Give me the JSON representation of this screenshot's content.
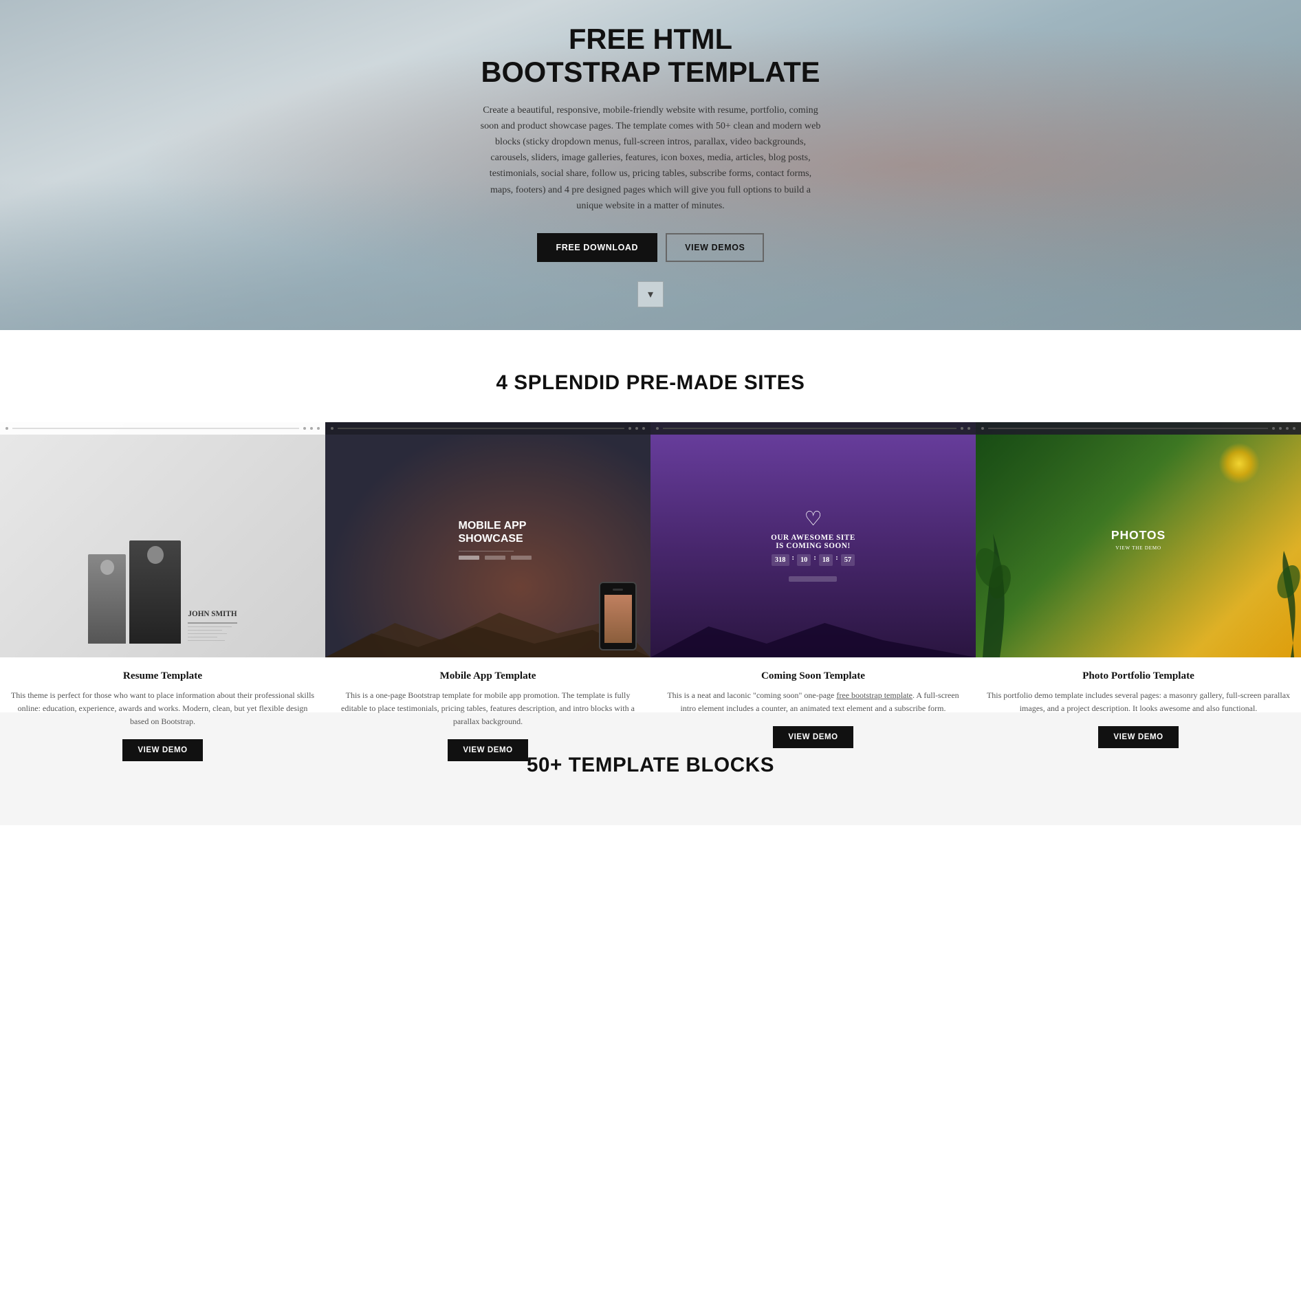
{
  "hero": {
    "title": "FREE HTML BOOTSTRAP TEMPLATE",
    "description": "Create a beautiful, responsive, mobile-friendly website with resume, portfolio, coming soon and product showcase pages. The template comes with 50+ clean and modern web blocks (sticky dropdown menus, full-screen intros, parallax, video backgrounds, carousels, sliders, image galleries, features, icon boxes, media, articles, blog posts, testimonials, social share, follow us, pricing tables, subscribe forms, contact forms, maps, footers) and 4 pre designed pages which will give you full options to build a unique website in a matter of minutes.",
    "btn_download": "FREE DOWNLOAD",
    "btn_demos": "VIEW DEMOS",
    "chevron": "▾"
  },
  "premade": {
    "section_title": "4 SPLENDID PRE-MADE SITES",
    "cards": [
      {
        "id": "resume",
        "title": "Resume Template",
        "description": "This theme is perfect for those who want to place information about their professional skills online: education, experience, awards and works. Modern, clean, but yet flexible design based on Bootstrap.",
        "btn_label": "VIEW DEMO",
        "name_label": "JOHN SMITH",
        "thumb_type": "resume"
      },
      {
        "id": "mobile",
        "title": "Mobile App Template",
        "description": "This is a one-page Bootstrap template for mobile app promotion. The template is fully editable to place testimonials, pricing tables, features description, and intro blocks with a parallax background.",
        "btn_label": "VIEW DEMO",
        "mobile_title": "MOBILE APP SHOWCASE",
        "thumb_type": "mobile"
      },
      {
        "id": "coming-soon",
        "title": "Coming Soon Template",
        "description": "This is a neat and laconic \"coming soon\" one-page free bootstrap template. A full-screen intro element includes a counter, an animated text element and a subscribe form.",
        "btn_label": "VIEW DEMO",
        "coming_text": "OUR AWESOME SITE IS COMING SOON!",
        "counter": "318 : 10 : 18 : 57",
        "thumb_type": "coming-soon"
      },
      {
        "id": "photo",
        "title": "Photo Portfolio Template",
        "description": "This portfolio demo template includes several pages: a masonry gallery, full-screen parallax images, and a project description. It looks awesome and also functional.",
        "btn_label": "VIEW DEMO",
        "photo_title": "PHOTOS",
        "thumb_type": "photo"
      }
    ]
  },
  "template_blocks": {
    "section_title": "50+ TEMPLATE BLOCKS"
  }
}
